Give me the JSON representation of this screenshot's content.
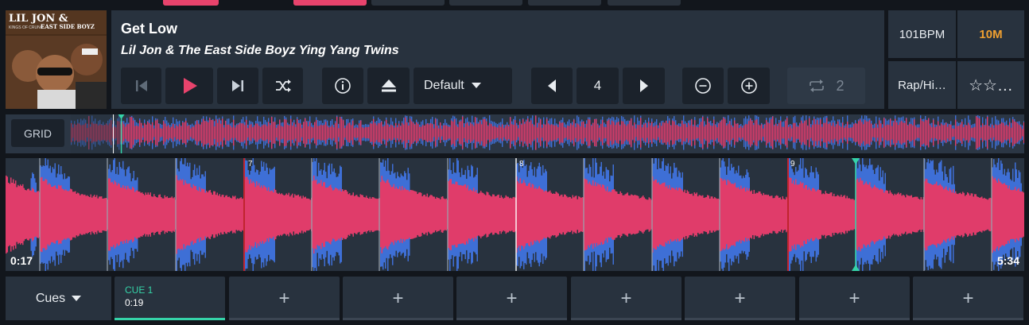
{
  "track": {
    "title": "Get Low",
    "artist": "Lil Jon & The East Side Boyz Ying Yang Twins",
    "bpm": "101BPM",
    "key": "10M",
    "genre": "Rap/Hi…",
    "rating_stars": "☆☆…",
    "key_color": "#f0a030"
  },
  "album_art": {
    "brand_line1": "LIL JON &",
    "brand_line2": "EAST SIDE BOYZ",
    "brand_line3": "KINGS OF CRUNK"
  },
  "controls": {
    "preset_label": "Default",
    "beat_jump_value": "4",
    "loop_value": "2"
  },
  "overview": {
    "grid_label": "GRID",
    "playhead_fraction": 0.053
  },
  "waveform": {
    "time_elapsed": "0:17",
    "time_remaining": "5:34",
    "bar_markers": [
      "7",
      "8",
      "9"
    ]
  },
  "cues": {
    "menu_label": "Cues",
    "slots": [
      {
        "label": "CUE 1",
        "time": "0:19",
        "set": true
      },
      {
        "label": "+",
        "set": false
      },
      {
        "label": "+",
        "set": false
      },
      {
        "label": "+",
        "set": false
      },
      {
        "label": "+",
        "set": false
      },
      {
        "label": "+",
        "set": false
      },
      {
        "label": "+",
        "set": false
      },
      {
        "label": "+",
        "set": false
      }
    ]
  },
  "colors": {
    "accent": "#e8436c",
    "cue_accent": "#35d3a8",
    "waveform_pink": "#e03c6a",
    "waveform_blue": "#3e6fd6"
  }
}
